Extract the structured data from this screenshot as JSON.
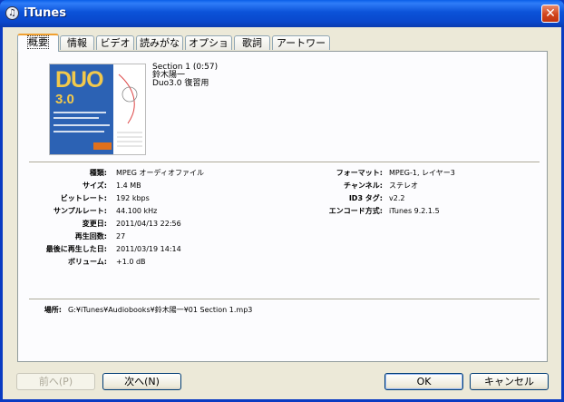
{
  "window": {
    "title": "iTunes",
    "icon": "itunes-icon"
  },
  "tabs": [
    "概要",
    "情報",
    "ビデオ",
    "読みがな",
    "オプション",
    "歌詞",
    "アートワーク"
  ],
  "track": {
    "title": "Section 1 (0:57)",
    "artist": "鈴木陽一",
    "album": "Duo3.0 復習用"
  },
  "artwork": {
    "title": "DUO",
    "version": "3.0"
  },
  "details_left": [
    {
      "label": "種類:",
      "value": "MPEG オーディオファイル"
    },
    {
      "label": "サイズ:",
      "value": "1.4 MB"
    },
    {
      "label": "ビットレート:",
      "value": "192 kbps"
    },
    {
      "label": "サンプルレート:",
      "value": "44.100 kHz"
    },
    {
      "label": "変更日:",
      "value": "2011/04/13 22:56"
    },
    {
      "label": "再生回数:",
      "value": "27"
    },
    {
      "label": "最後に再生した日:",
      "value": "2011/03/19 14:14"
    },
    {
      "label": "ボリューム:",
      "value": "+1.0 dB"
    }
  ],
  "details_right": [
    {
      "label": "フォーマット:",
      "value": "MPEG-1, レイヤー3"
    },
    {
      "label": "チャンネル:",
      "value": "ステレオ"
    },
    {
      "label": "ID3 タグ:",
      "value": "v2.2"
    },
    {
      "label": "エンコード方式:",
      "value": "iTunes 9.2.1.5"
    }
  ],
  "location": {
    "label": "場所:",
    "value": "G:¥iTunes¥Audiobooks¥鈴木陽一¥01 Section 1.mp3"
  },
  "buttons": {
    "prev": "前へ(P)",
    "next": "次へ(N)",
    "ok": "OK",
    "cancel": "キャンセル"
  },
  "colors": {
    "titlebar": "#0a48cc",
    "dialog_bg": "#ece9d8",
    "panel_bg": "#fcfcfe",
    "active_tab_accent": "#f0a030"
  }
}
